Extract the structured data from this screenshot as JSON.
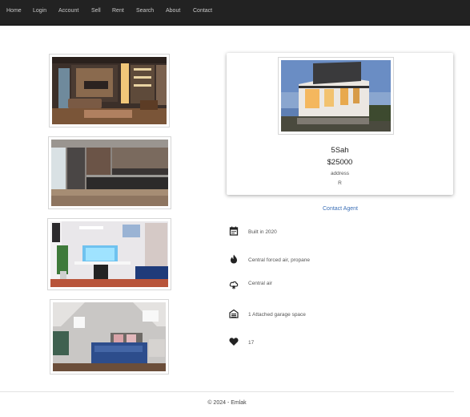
{
  "nav": {
    "items": [
      {
        "label": "Home"
      },
      {
        "label": "Login"
      },
      {
        "label": "Account"
      },
      {
        "label": "Sell"
      },
      {
        "label": "Rent"
      },
      {
        "label": "Search"
      },
      {
        "label": "About"
      },
      {
        "label": "Contact"
      }
    ]
  },
  "gallery": {
    "images": [
      {
        "subject": "living room"
      },
      {
        "subject": "kitchen"
      },
      {
        "subject": "home office"
      },
      {
        "subject": "bedroom"
      }
    ]
  },
  "listing": {
    "name": "5Sah",
    "price": "$25000",
    "address": "address",
    "type": "R",
    "contact_label": "Contact Agent"
  },
  "features": [
    {
      "icon": "calendar-icon",
      "text": "Built in 2020"
    },
    {
      "icon": "flame-icon",
      "text": "Central forced air, propane"
    },
    {
      "icon": "snowflake-cloud-icon",
      "text": "Central air"
    },
    {
      "icon": "garage-icon",
      "text": "1 Attached garage space"
    },
    {
      "icon": "heart-icon",
      "text": "17"
    }
  ],
  "footer": {
    "text": "© 2024 - Emlak"
  }
}
